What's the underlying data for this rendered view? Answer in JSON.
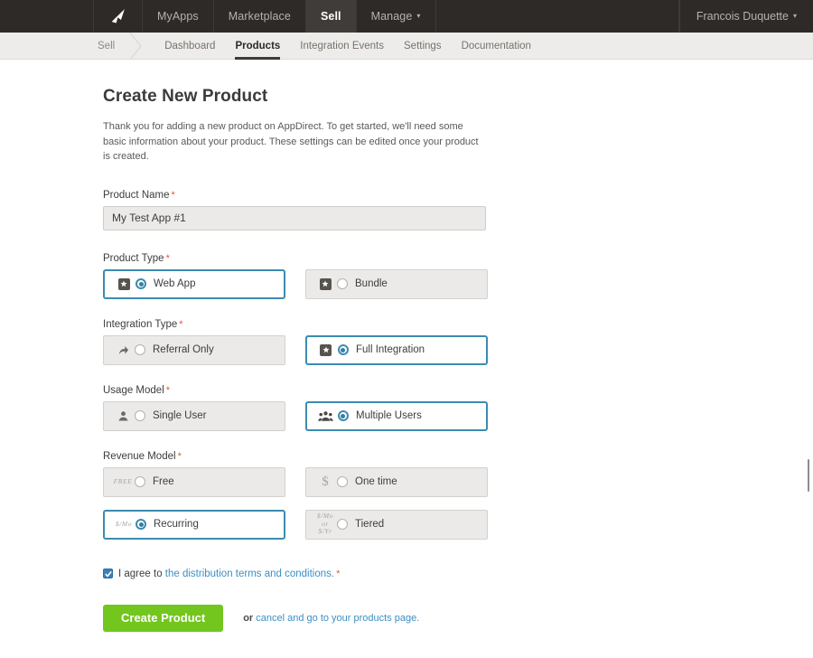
{
  "topnav": {
    "logo_name": "appdirect-logo",
    "items": [
      {
        "label": "MyApps",
        "active": false
      },
      {
        "label": "Marketplace",
        "active": false
      },
      {
        "label": "Sell",
        "active": true
      },
      {
        "label": "Manage",
        "active": false,
        "caret": true
      }
    ],
    "user": {
      "name": "Francois Duquette",
      "caret": "▾"
    }
  },
  "subnav": {
    "breadcrumb": "Sell",
    "items": [
      {
        "label": "Dashboard",
        "active": false
      },
      {
        "label": "Products",
        "active": true
      },
      {
        "label": "Integration Events",
        "active": false
      },
      {
        "label": "Settings",
        "active": false
      },
      {
        "label": "Documentation",
        "active": false
      }
    ]
  },
  "main": {
    "title": "Create New Product",
    "intro": "Thank you for adding a new product on AppDirect. To get started, we'll need some basic information about your product. These settings can be edited once your product is created.",
    "required_marker": "*",
    "fields": {
      "product_name": {
        "label": "Product Name",
        "value": "My Test App #1",
        "placeholder": ""
      },
      "product_type": {
        "label": "Product Type",
        "options": [
          {
            "label": "Web App",
            "icon": "badge-star-icon",
            "selected": true
          },
          {
            "label": "Bundle",
            "icon": "badge-star-icon",
            "selected": false
          }
        ]
      },
      "integration_type": {
        "label": "Integration Type",
        "options": [
          {
            "label": "Referral Only",
            "icon": "reply-arrow-icon",
            "selected": false
          },
          {
            "label": "Full Integration",
            "icon": "badge-star-icon",
            "selected": true
          }
        ]
      },
      "usage_model": {
        "label": "Usage Model",
        "options": [
          {
            "label": "Single User",
            "icon": "single-user-icon",
            "selected": false
          },
          {
            "label": "Multiple Users",
            "icon": "multiple-users-icon",
            "selected": true
          }
        ]
      },
      "revenue_model": {
        "label": "Revenue Model",
        "options": [
          {
            "label": "Free",
            "icon": "free-text-icon",
            "icon_text": "FREE",
            "selected": false
          },
          {
            "label": "One time",
            "icon": "dollar-icon",
            "icon_text": "$",
            "selected": false
          },
          {
            "label": "Recurring",
            "icon": "per-month-text-icon",
            "icon_text": "$/Mo",
            "selected": true
          },
          {
            "label": "Tiered",
            "icon": "per-month-or-year-text-icon",
            "icon_text_line1": "$/Mo",
            "icon_text_line2": "or",
            "icon_text_line3": "$/Yr",
            "selected": false
          }
        ]
      }
    },
    "agreement": {
      "checked": true,
      "prefix": "I agree to ",
      "link": "the distribution terms and conditions.",
      "required_marker": "*"
    },
    "actions": {
      "submit_label": "Create Product",
      "or_word": "or",
      "cancel_link": "cancel and go to your products page."
    }
  },
  "colors": {
    "topnav_bg": "#2d2a28",
    "subnav_bg": "#eeecea",
    "accent_blue": "#3c8bb0",
    "link_blue": "#3c8fc4",
    "required_red": "#e2583e",
    "submit_green": "#72c61d",
    "input_bg": "#eceae8"
  }
}
